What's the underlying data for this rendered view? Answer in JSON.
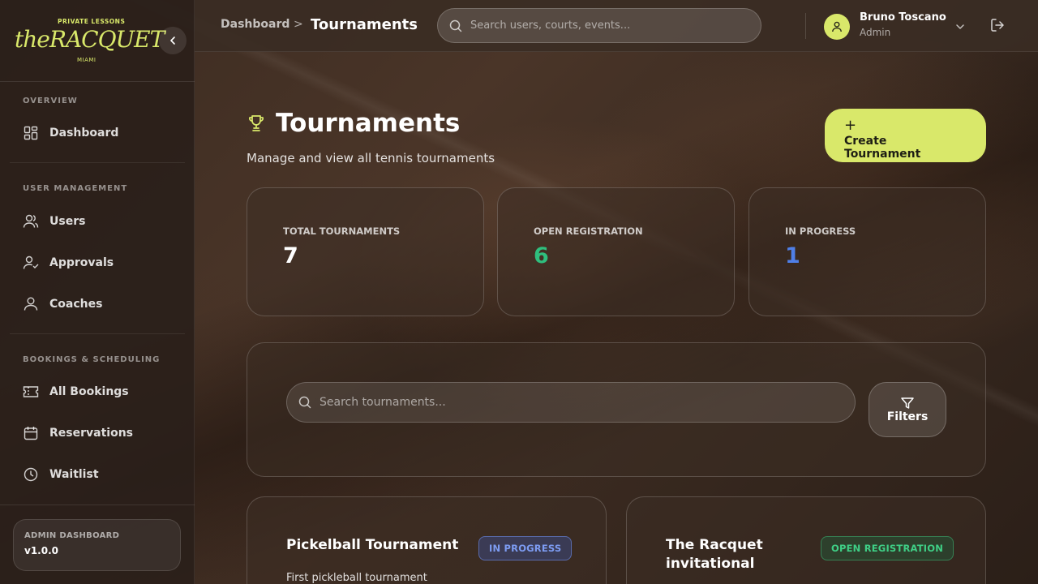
{
  "brand": {
    "top": "PRIVATE LESSONS",
    "logo": "theRACQUET",
    "sub": "MIAMI"
  },
  "sidebar": {
    "sections": [
      {
        "title": "OVERVIEW",
        "items": [
          {
            "label": "Dashboard",
            "icon": "dashboard-icon"
          }
        ]
      },
      {
        "title": "USER MANAGEMENT",
        "items": [
          {
            "label": "Users",
            "icon": "users-icon"
          },
          {
            "label": "Approvals",
            "icon": "user-check-icon"
          },
          {
            "label": "Coaches",
            "icon": "user-icon"
          }
        ]
      },
      {
        "title": "BOOKINGS & SCHEDULING",
        "items": [
          {
            "label": "All Bookings",
            "icon": "ticket-icon"
          },
          {
            "label": "Reservations",
            "icon": "calendar-icon"
          },
          {
            "label": "Waitlist",
            "icon": "clock-icon"
          }
        ]
      }
    ],
    "footer": {
      "label": "ADMIN DASHBOARD",
      "version": "v1.0.0"
    }
  },
  "header": {
    "breadcrumb": {
      "parent": "Dashboard",
      "separator": ">",
      "current": "Tournaments"
    },
    "search_placeholder": "Search users, courts, events...",
    "user": {
      "name": "Bruno Toscano",
      "role": "Admin"
    }
  },
  "page": {
    "title": "Tournaments",
    "subtitle": "Manage and view all tennis tournaments",
    "create_button": {
      "plus": "+",
      "label": "Create Tournament"
    }
  },
  "stats": [
    {
      "label": "TOTAL TOURNAMENTS",
      "value": "7",
      "color": "#ffffff"
    },
    {
      "label": "OPEN REGISTRATION",
      "value": "6",
      "color": "#2fbf7e"
    },
    {
      "label": "IN PROGRESS",
      "value": "1",
      "color": "#4f7fe8"
    }
  ],
  "filters": {
    "search_placeholder": "Search tournaments...",
    "filters_label": "Filters"
  },
  "tournaments": [
    {
      "name": "Pickelball Tournament",
      "status": "IN PROGRESS",
      "description": "First pickleball tournament"
    },
    {
      "name_line1": "The Racquet",
      "name_line2": "invitational",
      "status": "OPEN REGISTRATION"
    }
  ],
  "colors": {
    "accent": "#d9e86a",
    "status_blue": "#7d9cf2",
    "status_green": "#3fcf86"
  }
}
